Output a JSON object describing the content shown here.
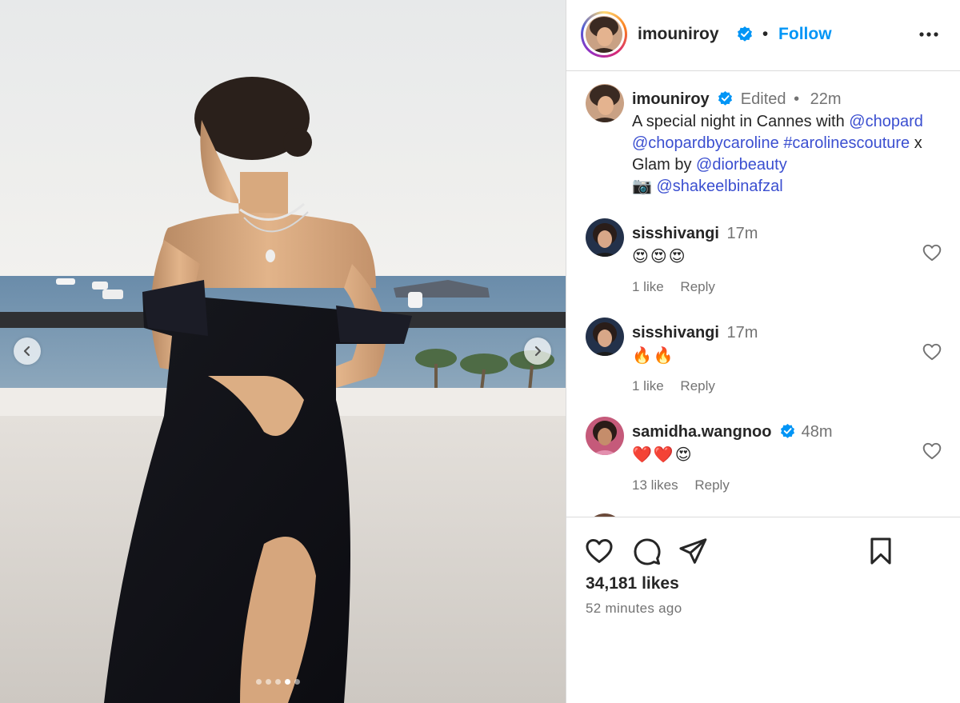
{
  "post": {
    "username": "imouniroy",
    "follow_separator": "•",
    "follow_label": "Follow",
    "carousel": {
      "total_images": 5,
      "active_index": 3
    },
    "caption": {
      "username": "imouniroy",
      "edited_label": "Edited",
      "separator": "•",
      "time": "22m",
      "text_1": "A special night in Cannes with ",
      "mention_1": "@chopard",
      "mention_2": "@chopardbycaroline",
      "hashtag_1": "#carolinescouture",
      "text_2": " x",
      "text_3": "Glam by ",
      "mention_3": "@diorbeauty",
      "camera_emoji": "📷",
      "mention_4": "@shakeelbinafzal"
    },
    "comments": [
      {
        "username": "sisshivangi",
        "verified": false,
        "time": "17m",
        "text": "😍😍😍",
        "likes_label": "1 like",
        "reply_label": "Reply"
      },
      {
        "username": "sisshivangi",
        "verified": false,
        "time": "17m",
        "text": "🔥🔥",
        "likes_label": "1 like",
        "reply_label": "Reply"
      },
      {
        "username": "samidha.wangnoo",
        "verified": true,
        "time": "48m",
        "text": "❤️❤️😍",
        "likes_label": "13 likes",
        "reply_label": "Reply"
      }
    ],
    "likes_count": "34,181 likes",
    "posted_time": "52 minutes ago"
  },
  "icons": {
    "like": "heart-icon",
    "comment": "comment-icon",
    "share": "share-icon",
    "save": "bookmark-icon",
    "more": "more-options-icon",
    "verified": "verified-badge-icon",
    "prev": "chevron-left-icon",
    "next": "chevron-right-icon"
  },
  "colors": {
    "follow": "#0095f6",
    "link": "#3b4fd0",
    "verified": "#0095f6",
    "muted": "#737373",
    "border": "#dbdbdb"
  }
}
